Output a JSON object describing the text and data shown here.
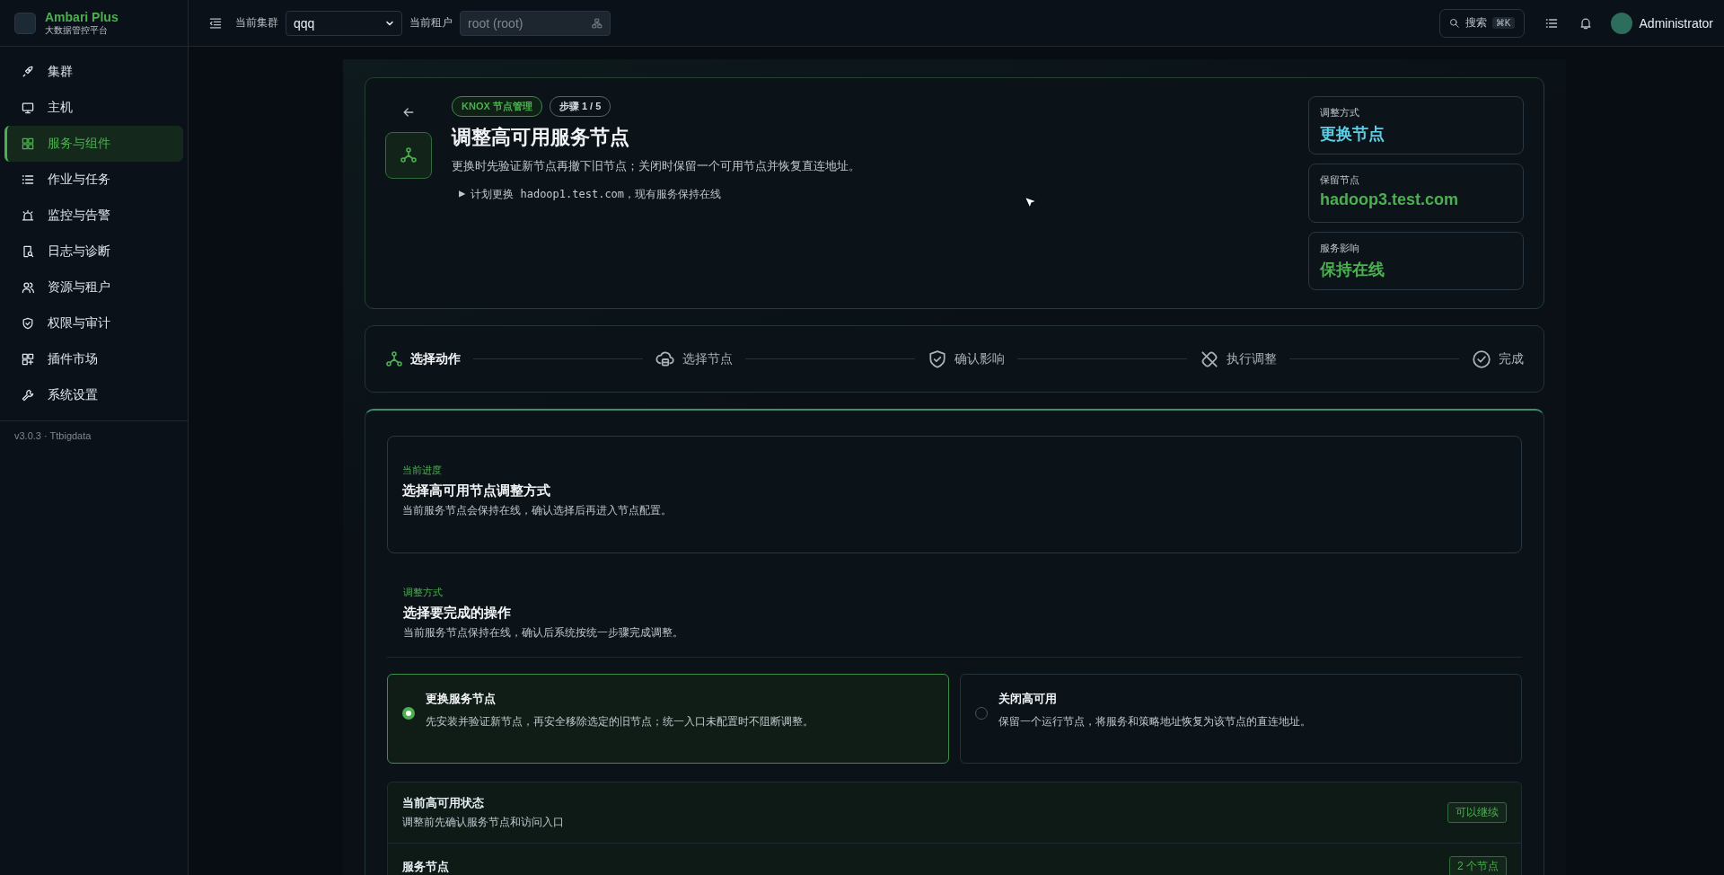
{
  "brand": {
    "name": "Ambari Plus",
    "subtitle": "大数据管控平台"
  },
  "sidebar": {
    "items": [
      {
        "label": "集群",
        "selected": false
      },
      {
        "label": "主机",
        "selected": false
      },
      {
        "label": "服务与组件",
        "selected": true
      },
      {
        "label": "作业与任务",
        "selected": false
      },
      {
        "label": "监控与告警",
        "selected": false
      },
      {
        "label": "日志与诊断",
        "selected": false
      },
      {
        "label": "资源与租户",
        "selected": false
      },
      {
        "label": "权限与审计",
        "selected": false
      },
      {
        "label": "插件市场",
        "selected": false
      },
      {
        "label": "系统设置",
        "selected": false
      }
    ],
    "version": "v3.0.3 · Ttbigdata"
  },
  "topbar": {
    "cluster": {
      "label": "当前集群",
      "value": "qqq"
    },
    "tenant": {
      "label": "当前租户",
      "value": "root (root)",
      "disabled": true
    },
    "search": {
      "label": "搜索",
      "shortcut": "⌘K"
    },
    "user": "Administrator"
  },
  "hero": {
    "tag": "KNOX 节点管理",
    "step": "步骤 1 / 5",
    "title": "调整高可用服务节点",
    "description": "更换时先验证新节点再撤下旧节点；关闭时保留一个可用节点并恢复直连地址。",
    "plan_marker": "▶",
    "plan": "计划更换 hadoop1.test.com，现有服务保持在线",
    "summary": [
      {
        "label": "调整方式",
        "value": "更换节点",
        "color": "#5ccfe6"
      },
      {
        "label": "保留节点",
        "value": "hadoop3.test.com",
        "color": "#4caf50"
      },
      {
        "label": "服务影响",
        "value": "保持在线",
        "color": "#4caf50"
      }
    ]
  },
  "steps": [
    {
      "label": "选择动作",
      "selected": true
    },
    {
      "label": "选择节点",
      "selected": false
    },
    {
      "label": "确认影响",
      "selected": false
    },
    {
      "label": "执行调整",
      "selected": false
    },
    {
      "label": "完成",
      "selected": false
    }
  ],
  "progress": {
    "eyebrow": "当前进度",
    "title": "选择高可用节点调整方式",
    "description": "当前服务节点会保持在线，确认选择后再进入节点配置。"
  },
  "mode": {
    "eyebrow": "调整方式",
    "title": "选择要完成的操作",
    "description": "当前服务节点保持在线，确认后系统按统一步骤完成调整。"
  },
  "options": [
    {
      "title": "更换服务节点",
      "description": "先安装并验证新节点，再安全移除选定的旧节点；统一入口未配置时不阻断调整。",
      "selected": true
    },
    {
      "title": "关闭高可用",
      "description": "保留一个运行节点，将服务和策略地址恢复为该节点的直连地址。",
      "selected": false
    }
  ],
  "status_rows": [
    {
      "title": "当前高可用状态",
      "description": "调整前先确认服务节点和访问入口",
      "badge": "可以继续"
    },
    {
      "title": "服务节点",
      "badge": "2 个节点"
    }
  ]
}
